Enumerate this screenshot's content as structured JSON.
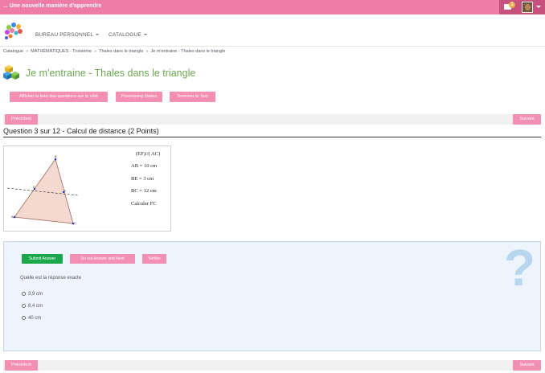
{
  "topbar": {
    "slogan": "... Une nouvelle manière d'apprendre",
    "mail_count": "1"
  },
  "nav": {
    "items": [
      {
        "label": "BUREAU PERSONNEL"
      },
      {
        "label": "CATALOGUE"
      }
    ]
  },
  "breadcrumb": {
    "items": [
      "Catalogue",
      "MATHÉMATIQUES - Troisième",
      "Thales dans le triangle",
      "Je m'entraine - Thales dans le triangle"
    ],
    "sep": "»"
  },
  "page": {
    "title": "Je m'entraine - Thales dans le triangle"
  },
  "toolbar": {
    "list_label": "Afficher la liste des questions sur le côté",
    "status_label": "Processing Status",
    "end_label": "Terminer le Test"
  },
  "pager": {
    "prev_label": "Précédent",
    "next_label": "Suivant"
  },
  "question": {
    "title": "Question 3 sur 12 - Calcul de distance (2 Points)",
    "figure_lines": [
      "(EF)//( AC)",
      "AB = 10 cm",
      "BE = 3 cm",
      "BC = 12 cm",
      "Calculer FC"
    ],
    "points": {
      "a": "A",
      "b": "B",
      "c": "C",
      "e": "E",
      "f": "F"
    }
  },
  "answer": {
    "submit_label": "Submit Answer",
    "skip_label": "Do not Answer and Next",
    "check_label": "Vérifier",
    "instruction": "Quelle est la réponse exacte",
    "options": [
      "3,9 cm",
      "8,4 cm",
      "40 cm"
    ],
    "hint_glyph": "?"
  },
  "colors": {
    "brand_pink": "#ef7ba7",
    "button_pink": "#f28fb3",
    "title_green": "#6aa84f",
    "submit_green": "#1aa84a"
  }
}
